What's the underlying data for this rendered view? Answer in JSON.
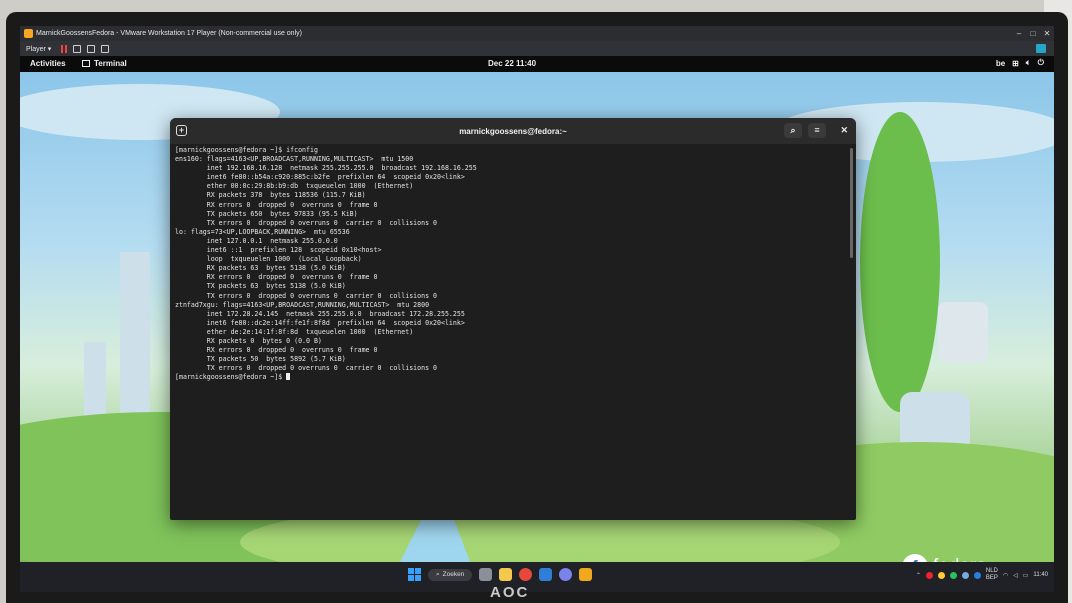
{
  "vmware": {
    "title": "MarnickGoossensFedora - VMware Workstation 17 Player (Non-commercial use only)",
    "player_label": "Player ▾"
  },
  "gnome": {
    "activities": "Activities",
    "app_name": "Terminal",
    "clock": "Dec 22  11:40",
    "tray_text": "be"
  },
  "terminal": {
    "title": "marnickgoossens@fedora:~",
    "lines": [
      "[marnickgoossens@fedora ~]$ ifconfig",
      "ens160: flags=4163<UP,BROADCAST,RUNNING,MULTICAST>  mtu 1500",
      "        inet 192.168.16.128  netmask 255.255.255.0  broadcast 192.168.16.255",
      "        inet6 fe80::b54a:c920:885c:b2fe  prefixlen 64  scopeid 0x20<link>",
      "        ether 00:0c:29:8b:b9:db  txqueuelen 1000  (Ethernet)",
      "        RX packets 378  bytes 118536 (115.7 KiB)",
      "        RX errors 0  dropped 0  overruns 0  frame 0",
      "        TX packets 650  bytes 97833 (95.5 KiB)",
      "        TX errors 0  dropped 0 overruns 0  carrier 0  collisions 0",
      "",
      "lo: flags=73<UP,LOOPBACK,RUNNING>  mtu 65536",
      "        inet 127.0.0.1  netmask 255.0.0.0",
      "        inet6 ::1  prefixlen 128  scopeid 0x10<host>",
      "        loop  txqueuelen 1000  (Local Loopback)",
      "        RX packets 63  bytes 5138 (5.0 KiB)",
      "        RX errors 0  dropped 0  overruns 0  frame 0",
      "        TX packets 63  bytes 5138 (5.0 KiB)",
      "        TX errors 0  dropped 0 overruns 0  carrier 0  collisions 0",
      "",
      "ztnfad7xgu: flags=4163<UP,BROADCAST,RUNNING,MULTICAST>  mtu 2800",
      "        inet 172.28.24.145  netmask 255.255.0.0  broadcast 172.28.255.255",
      "        inet6 fe80::dc2e:14ff:fe1f:8f8d  prefixlen 64  scopeid 0x20<link>",
      "        ether de:2e:14:1f:8f:8d  txqueuelen 1000  (Ethernet)",
      "        RX packets 0  bytes 0 (0.0 B)",
      "        RX errors 0  dropped 0  overruns 0  frame 0",
      "        TX packets 50  bytes 5892 (5.7 KiB)",
      "        TX errors 0  dropped 0 overruns 0  carrier 0  collisions 0",
      ""
    ],
    "prompt": "[marnickgoossens@fedora ~]$ "
  },
  "desktop": {
    "fedora_logo_text": "fedora"
  },
  "taskbar": {
    "search_label": "Zoeken",
    "lang_line1": "NLD",
    "lang_line2": "BEP",
    "time": "11:40"
  },
  "monitor": {
    "brand": "AOC"
  }
}
